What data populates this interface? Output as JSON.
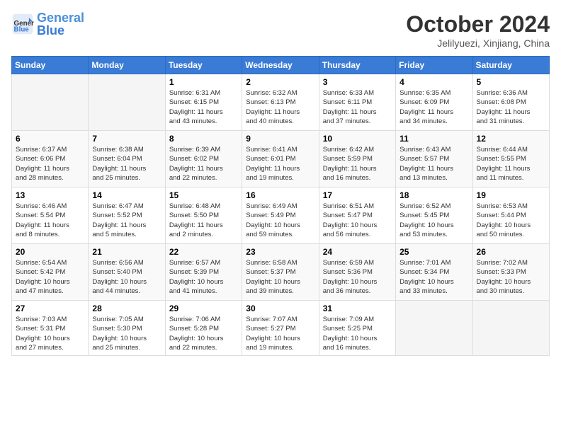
{
  "header": {
    "logo_line1": "General",
    "logo_line2": "Blue",
    "month_title": "October 2024",
    "location": "Jelilyuezi, Xinjiang, China"
  },
  "weekdays": [
    "Sunday",
    "Monday",
    "Tuesday",
    "Wednesday",
    "Thursday",
    "Friday",
    "Saturday"
  ],
  "weeks": [
    [
      {
        "day": "",
        "info": ""
      },
      {
        "day": "",
        "info": ""
      },
      {
        "day": "1",
        "info": "Sunrise: 6:31 AM\nSunset: 6:15 PM\nDaylight: 11 hours\nand 43 minutes."
      },
      {
        "day": "2",
        "info": "Sunrise: 6:32 AM\nSunset: 6:13 PM\nDaylight: 11 hours\nand 40 minutes."
      },
      {
        "day": "3",
        "info": "Sunrise: 6:33 AM\nSunset: 6:11 PM\nDaylight: 11 hours\nand 37 minutes."
      },
      {
        "day": "4",
        "info": "Sunrise: 6:35 AM\nSunset: 6:09 PM\nDaylight: 11 hours\nand 34 minutes."
      },
      {
        "day": "5",
        "info": "Sunrise: 6:36 AM\nSunset: 6:08 PM\nDaylight: 11 hours\nand 31 minutes."
      }
    ],
    [
      {
        "day": "6",
        "info": "Sunrise: 6:37 AM\nSunset: 6:06 PM\nDaylight: 11 hours\nand 28 minutes."
      },
      {
        "day": "7",
        "info": "Sunrise: 6:38 AM\nSunset: 6:04 PM\nDaylight: 11 hours\nand 25 minutes."
      },
      {
        "day": "8",
        "info": "Sunrise: 6:39 AM\nSunset: 6:02 PM\nDaylight: 11 hours\nand 22 minutes."
      },
      {
        "day": "9",
        "info": "Sunrise: 6:41 AM\nSunset: 6:01 PM\nDaylight: 11 hours\nand 19 minutes."
      },
      {
        "day": "10",
        "info": "Sunrise: 6:42 AM\nSunset: 5:59 PM\nDaylight: 11 hours\nand 16 minutes."
      },
      {
        "day": "11",
        "info": "Sunrise: 6:43 AM\nSunset: 5:57 PM\nDaylight: 11 hours\nand 13 minutes."
      },
      {
        "day": "12",
        "info": "Sunrise: 6:44 AM\nSunset: 5:55 PM\nDaylight: 11 hours\nand 11 minutes."
      }
    ],
    [
      {
        "day": "13",
        "info": "Sunrise: 6:46 AM\nSunset: 5:54 PM\nDaylight: 11 hours\nand 8 minutes."
      },
      {
        "day": "14",
        "info": "Sunrise: 6:47 AM\nSunset: 5:52 PM\nDaylight: 11 hours\nand 5 minutes."
      },
      {
        "day": "15",
        "info": "Sunrise: 6:48 AM\nSunset: 5:50 PM\nDaylight: 11 hours\nand 2 minutes."
      },
      {
        "day": "16",
        "info": "Sunrise: 6:49 AM\nSunset: 5:49 PM\nDaylight: 10 hours\nand 59 minutes."
      },
      {
        "day": "17",
        "info": "Sunrise: 6:51 AM\nSunset: 5:47 PM\nDaylight: 10 hours\nand 56 minutes."
      },
      {
        "day": "18",
        "info": "Sunrise: 6:52 AM\nSunset: 5:45 PM\nDaylight: 10 hours\nand 53 minutes."
      },
      {
        "day": "19",
        "info": "Sunrise: 6:53 AM\nSunset: 5:44 PM\nDaylight: 10 hours\nand 50 minutes."
      }
    ],
    [
      {
        "day": "20",
        "info": "Sunrise: 6:54 AM\nSunset: 5:42 PM\nDaylight: 10 hours\nand 47 minutes."
      },
      {
        "day": "21",
        "info": "Sunrise: 6:56 AM\nSunset: 5:40 PM\nDaylight: 10 hours\nand 44 minutes."
      },
      {
        "day": "22",
        "info": "Sunrise: 6:57 AM\nSunset: 5:39 PM\nDaylight: 10 hours\nand 41 minutes."
      },
      {
        "day": "23",
        "info": "Sunrise: 6:58 AM\nSunset: 5:37 PM\nDaylight: 10 hours\nand 39 minutes."
      },
      {
        "day": "24",
        "info": "Sunrise: 6:59 AM\nSunset: 5:36 PM\nDaylight: 10 hours\nand 36 minutes."
      },
      {
        "day": "25",
        "info": "Sunrise: 7:01 AM\nSunset: 5:34 PM\nDaylight: 10 hours\nand 33 minutes."
      },
      {
        "day": "26",
        "info": "Sunrise: 7:02 AM\nSunset: 5:33 PM\nDaylight: 10 hours\nand 30 minutes."
      }
    ],
    [
      {
        "day": "27",
        "info": "Sunrise: 7:03 AM\nSunset: 5:31 PM\nDaylight: 10 hours\nand 27 minutes."
      },
      {
        "day": "28",
        "info": "Sunrise: 7:05 AM\nSunset: 5:30 PM\nDaylight: 10 hours\nand 25 minutes."
      },
      {
        "day": "29",
        "info": "Sunrise: 7:06 AM\nSunset: 5:28 PM\nDaylight: 10 hours\nand 22 minutes."
      },
      {
        "day": "30",
        "info": "Sunrise: 7:07 AM\nSunset: 5:27 PM\nDaylight: 10 hours\nand 19 minutes."
      },
      {
        "day": "31",
        "info": "Sunrise: 7:09 AM\nSunset: 5:25 PM\nDaylight: 10 hours\nand 16 minutes."
      },
      {
        "day": "",
        "info": ""
      },
      {
        "day": "",
        "info": ""
      }
    ]
  ]
}
